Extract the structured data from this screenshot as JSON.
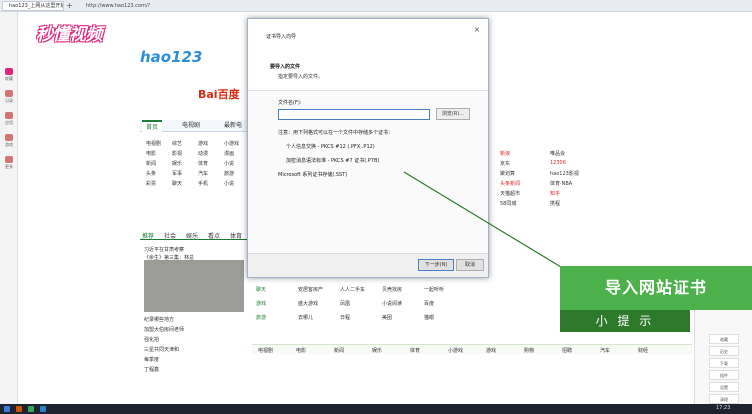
{
  "browser": {
    "tab_label": "hao123_上网从这里开始",
    "new_tab": "+",
    "url": "http://www.hao123.com/?"
  },
  "watermark_logo": "秒懂视频",
  "sidebar": [
    {
      "label": "收藏",
      "color": "#e2247d"
    },
    {
      "label": "记录",
      "color": "#d47575"
    },
    {
      "label": "应用",
      "color": "#d47575"
    },
    {
      "label": "游戏",
      "color": "#d47575"
    },
    {
      "label": "更多",
      "color": "#d47575"
    }
  ],
  "page": {
    "hao123_logo": "hao123",
    "baidu_logo": "Bai百度",
    "nav_tabs": [
      "首页",
      "电视剧",
      "最新电"
    ],
    "links": [
      "电视剧",
      "综艺",
      "游戏",
      "小游戏",
      "电影",
      "影视",
      "动漫",
      "漫画",
      "新闻",
      "娱乐",
      "体育",
      "小说",
      "头条",
      "军事",
      "汽车",
      "旅游",
      "彩票",
      "聊天",
      "手机",
      "小说"
    ],
    "news_tabs": [
      "推荐",
      "社会",
      "娱乐",
      "看点",
      "体育"
    ],
    "news_items": [
      "习近平在甘肃考察",
      "《余生》第三集：林总",
      "纪录哪些地方",
      "加盟大伯房间老师",
      "强化拍",
      "三星共同天津和",
      "每季度",
      "丁程鑫"
    ],
    "right_col": [
      "新浪",
      "唯品会",
      "京东",
      "12306",
      "聚划算",
      "hao123影视",
      "头条新闻",
      "体育·NBA",
      "天猫超市",
      "知乎",
      "58同城",
      "携程"
    ],
    "grid_rows": [
      [
        "购物",
        "六间房直播",
        "苏宁年终盛",
        "72星游戏平台",
        "斗鱼视频"
      ],
      [
        "聊天",
        "安居客房产",
        "人人二手车",
        "贝壳找房",
        "一起听听"
      ],
      [
        "游戏",
        "盛大游戏",
        "凤凰",
        "小说阅读",
        "百度"
      ],
      [
        "旅游",
        "去哪儿",
        "日程",
        "美团",
        "猫眼"
      ]
    ],
    "bottom_nav": [
      "电视剧",
      "电影",
      "新闻",
      "娱乐",
      "体育",
      "小游戏",
      "游戏",
      "购物",
      "招聘",
      "汽车",
      "财经"
    ]
  },
  "dialog": {
    "title": "证书导入向导",
    "close": "×",
    "header_title": "要导入的文件",
    "header_sub": "指定要导入的文件。",
    "file_label": "文件名(F):",
    "file_value": "",
    "browse": "浏览(R)...",
    "note": "注意：用下列格式可以在一个文件中存储多个证书：",
    "formats": [
      "个人信息交换 - PKCS #12 (.PFX,.P12)",
      "加密消息语法标准 - PKCS #7 证书(.P7B)",
      "Microsoft 系列证书存储(.SST)"
    ],
    "next": "下一步(N)",
    "cancel": "取消"
  },
  "overlay": {
    "banner": "导入网站证书",
    "tip": "小 提 示"
  },
  "right_panel": [
    "收藏",
    "历史",
    "下载",
    "插件",
    "设置",
    "清理"
  ],
  "taskbar": {
    "clock": "17:23"
  }
}
